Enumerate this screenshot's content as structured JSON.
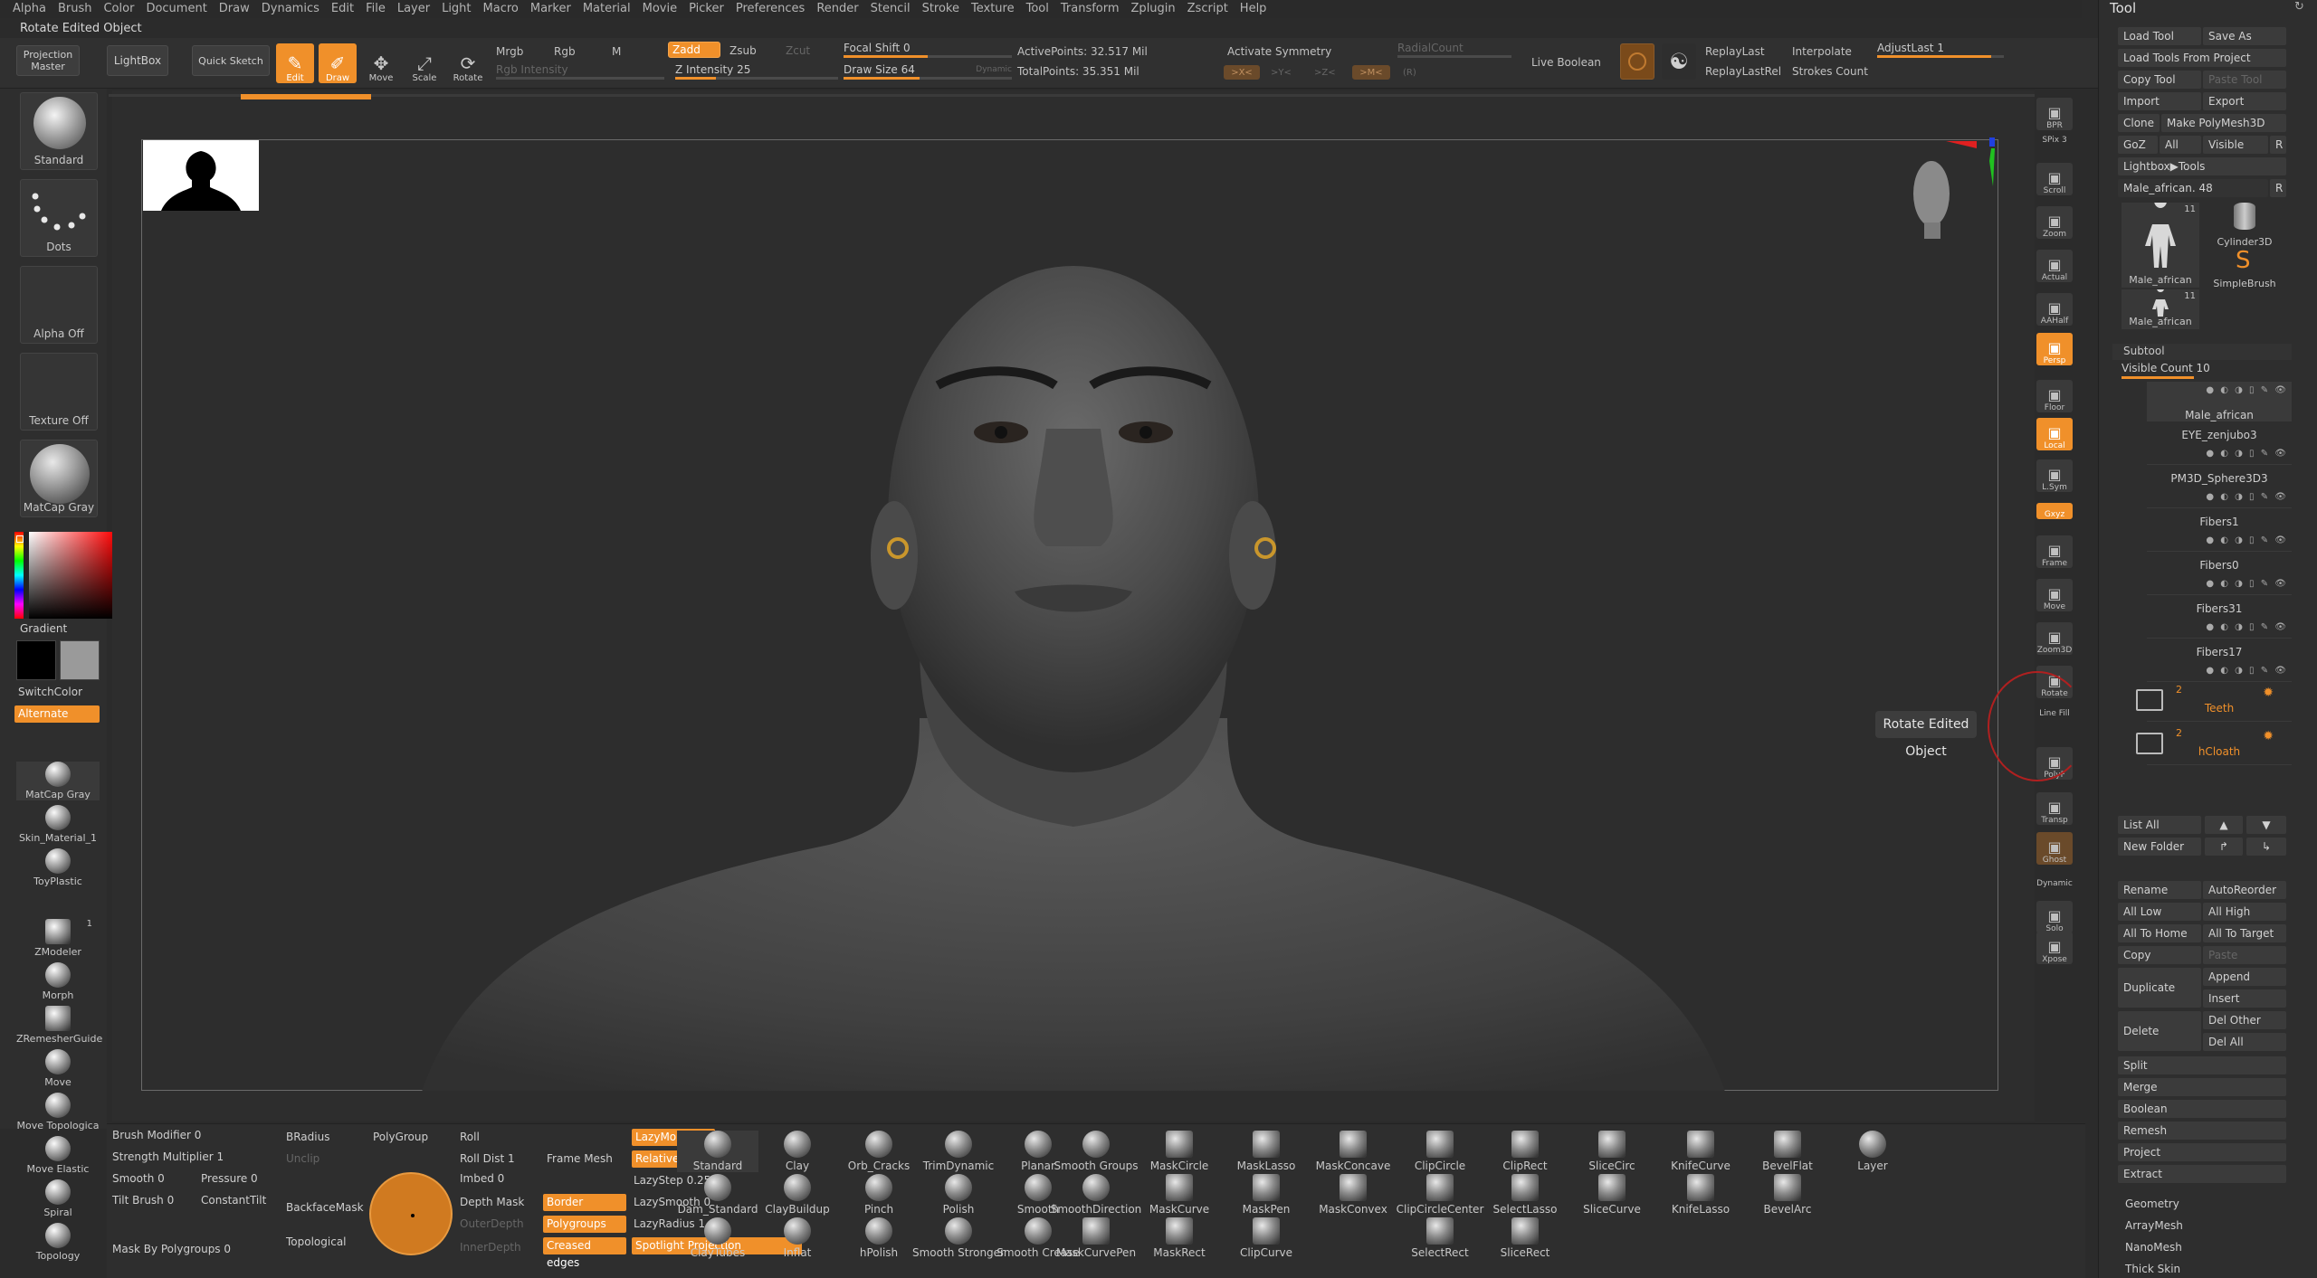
{
  "menu": [
    "Alpha",
    "Brush",
    "Color",
    "Document",
    "Draw",
    "Dynamics",
    "Edit",
    "File",
    "Layer",
    "Light",
    "Macro",
    "Marker",
    "Material",
    "Movie",
    "Picker",
    "Preferences",
    "Render",
    "Stencil",
    "Stroke",
    "Texture",
    "Tool",
    "Transform",
    "Zplugin",
    "Zscript",
    "Help"
  ],
  "title": "Rotate Edited Object",
  "top": {
    "projection_master": "Projection Master",
    "lightbox": "LightBox",
    "quick_sketch": "Quick Sketch",
    "edit": "Edit",
    "draw": "Draw",
    "move": "Move",
    "scale": "Scale",
    "rotate": "Rotate",
    "mrgb": "Mrgb",
    "rgb": "Rgb",
    "m": "M",
    "rgb_intensity": "Rgb Intensity",
    "zadd": "Zadd",
    "zsub": "Zsub",
    "zcut": "Zcut",
    "z_intensity": "Z Intensity 25",
    "z_intensity_value": 25,
    "focal_shift": "Focal Shift 0",
    "draw_size": "Draw Size 64",
    "draw_size_value": 64,
    "dynamic": "Dynamic",
    "active_points": "ActivePoints: 32.517 Mil",
    "total_points": "TotalPoints: 35.351 Mil",
    "activate_symmetry": "Activate Symmetry",
    "radial_count": "RadialCount",
    "sym_x": ">X<",
    "sym_y": ">Y<",
    "sym_z": ">Z<",
    "sym_m": ">M<",
    "sym_r": "(R)",
    "live_boolean": "Live Boolean",
    "replay_last": "ReplayLast",
    "replay_last_rel": "ReplayLastRel",
    "interpolate": "Interpolate",
    "strokes_count": "Strokes Count",
    "adjust_last": "AdjustLast 1"
  },
  "left": {
    "brush": "Standard",
    "stroke": "Dots",
    "alpha": "Alpha Off",
    "texture": "Texture Off",
    "material": "MatCap Gray",
    "gradient": "Gradient",
    "switch_color": "SwitchColor",
    "alternate": "Alternate",
    "materials": [
      "MatCap Gray",
      "Skin_Material_1",
      "ToyPlastic"
    ],
    "tools": [
      "ZModeler",
      "Morph",
      "ZRemesherGuide",
      "Move",
      "Move Topologica",
      "Move Elastic",
      "Spiral",
      "Topology"
    ],
    "zmodeler_count": "1"
  },
  "right_shelf": [
    "BPR",
    "SPix 3",
    "Scroll",
    "Zoom",
    "Actual",
    "AAHalf",
    "Persp",
    "Floor",
    "Local",
    "L.Sym",
    "Gxyz",
    "Frame",
    "Move",
    "Zoom3D",
    "Rotate",
    "Line Fill",
    "PolyF",
    "Transp",
    "Ghost",
    "Dynamic",
    "Solo",
    "Xpose"
  ],
  "tooltip": "Rotate Edited Object",
  "tool_panel": {
    "title": "Tool",
    "load_tool": "Load Tool",
    "save_as": "Save As",
    "load_from_project": "Load Tools From Project",
    "copy_tool": "Copy Tool",
    "paste_tool": "Paste Tool",
    "import": "Import",
    "export": "Export",
    "clone": "Clone",
    "make_polymesh": "Make PolyMesh3D",
    "goz": "GoZ",
    "all": "All",
    "visible": "Visible",
    "r": "R",
    "lightbox_tools": "Lightbox▶Tools",
    "current_tool": "Male_african. 48",
    "thumbs": [
      {
        "name": "Male_african",
        "count": "11"
      },
      {
        "name": "Cylinder3D",
        "count": ""
      },
      {
        "name": "SimpleBrush",
        "count": ""
      },
      {
        "name": "Male_african",
        "count": "11"
      }
    ],
    "subtool": "Subtool",
    "visible_count": "Visible Count 10",
    "subtools": [
      "Male_african",
      "EYE_zenjubo3",
      "PM3D_Sphere3D3",
      "Fibers1",
      "Fibers0",
      "Fibers31",
      "Fibers17"
    ],
    "folders": [
      {
        "name": "Teeth",
        "count": "2"
      },
      {
        "name": "hCloath",
        "count": "2"
      }
    ],
    "list_all": "List All",
    "new_folder": "New Folder",
    "rename": "Rename",
    "auto_reorder": "AutoReorder",
    "all_low": "All Low",
    "all_high": "All High",
    "all_to_home": "All To Home",
    "all_to_target": "All To Target",
    "copy": "Copy",
    "paste": "Paste",
    "duplicate": "Duplicate",
    "append": "Append",
    "insert": "Insert",
    "delete": "Delete",
    "del_other": "Del Other",
    "del_all": "Del All",
    "split": "Split",
    "merge": "Merge",
    "boolean": "Boolean",
    "remesh": "Remesh",
    "project": "Project",
    "extract": "Extract",
    "sections": [
      "Geometry",
      "ArrayMesh",
      "NanoMesh",
      "Thick Skin"
    ]
  },
  "bottom": {
    "brush_modifier": "Brush Modifier 0",
    "strength_multiplier": "Strength Multiplier 1",
    "smooth": "Smooth 0",
    "pressure": "Pressure 0",
    "tilt_brush": "Tilt Brush 0",
    "constant_tilt": "ConstantTilt",
    "mask_by_polygroups": "Mask By Polygroups 0",
    "bradius": "BRadius",
    "unclip": "Unclip",
    "backface_mask": "BackfaceMask",
    "topological": "Topological",
    "polygroup": "PolyGroup",
    "roll": "Roll",
    "roll_dist": "Roll Dist 1",
    "imbed": "Imbed 0",
    "depth_mask": "Depth Mask",
    "outer_depth": "OuterDepth",
    "inner_depth": "InnerDepth",
    "frame_mesh": "Frame Mesh",
    "border": "Border",
    "polygroups": "Polygroups",
    "creased_edges": "Creased edges",
    "lazymouse": "LazyMouse",
    "relative": "Relative",
    "lazystep": "LazyStep 0.25",
    "lazysmooth": "LazySmooth 0",
    "lazyradius": "LazyRadius 1",
    "spotlight_projection": "Spotlight Projection",
    "brushes": [
      "Standard",
      "Clay",
      "Orb_Cracks",
      "TrimDynamic",
      "Planar",
      "Smooth Groups",
      "MaskCircle",
      "MaskLasso",
      "MaskConcave",
      "ClipCircle",
      "ClipRect",
      "SliceCirc",
      "KnifeCurve",
      "BevelFlat",
      "Layer",
      "Dam_Standard",
      "ClayBuildup",
      "Pinch",
      "Polish",
      "Smooth",
      "SmoothDirection",
      "MaskCurve",
      "MaskPen",
      "MaskConvex",
      "ClipCircleCenter",
      "SelectLasso",
      "SliceCurve",
      "KnifeLasso",
      "BevelArc",
      "ClayTubes",
      "Inflat",
      "hPolish",
      "Smooth Stronger",
      "Smooth Crease",
      "MaskCurvePen",
      "MaskRect",
      "ClipCurve",
      "SelectRect",
      "SliceRect"
    ]
  },
  "colors": {
    "accent": "#f0902a",
    "bg": "#2b2b2b",
    "panel": "#2e2e2e"
  }
}
